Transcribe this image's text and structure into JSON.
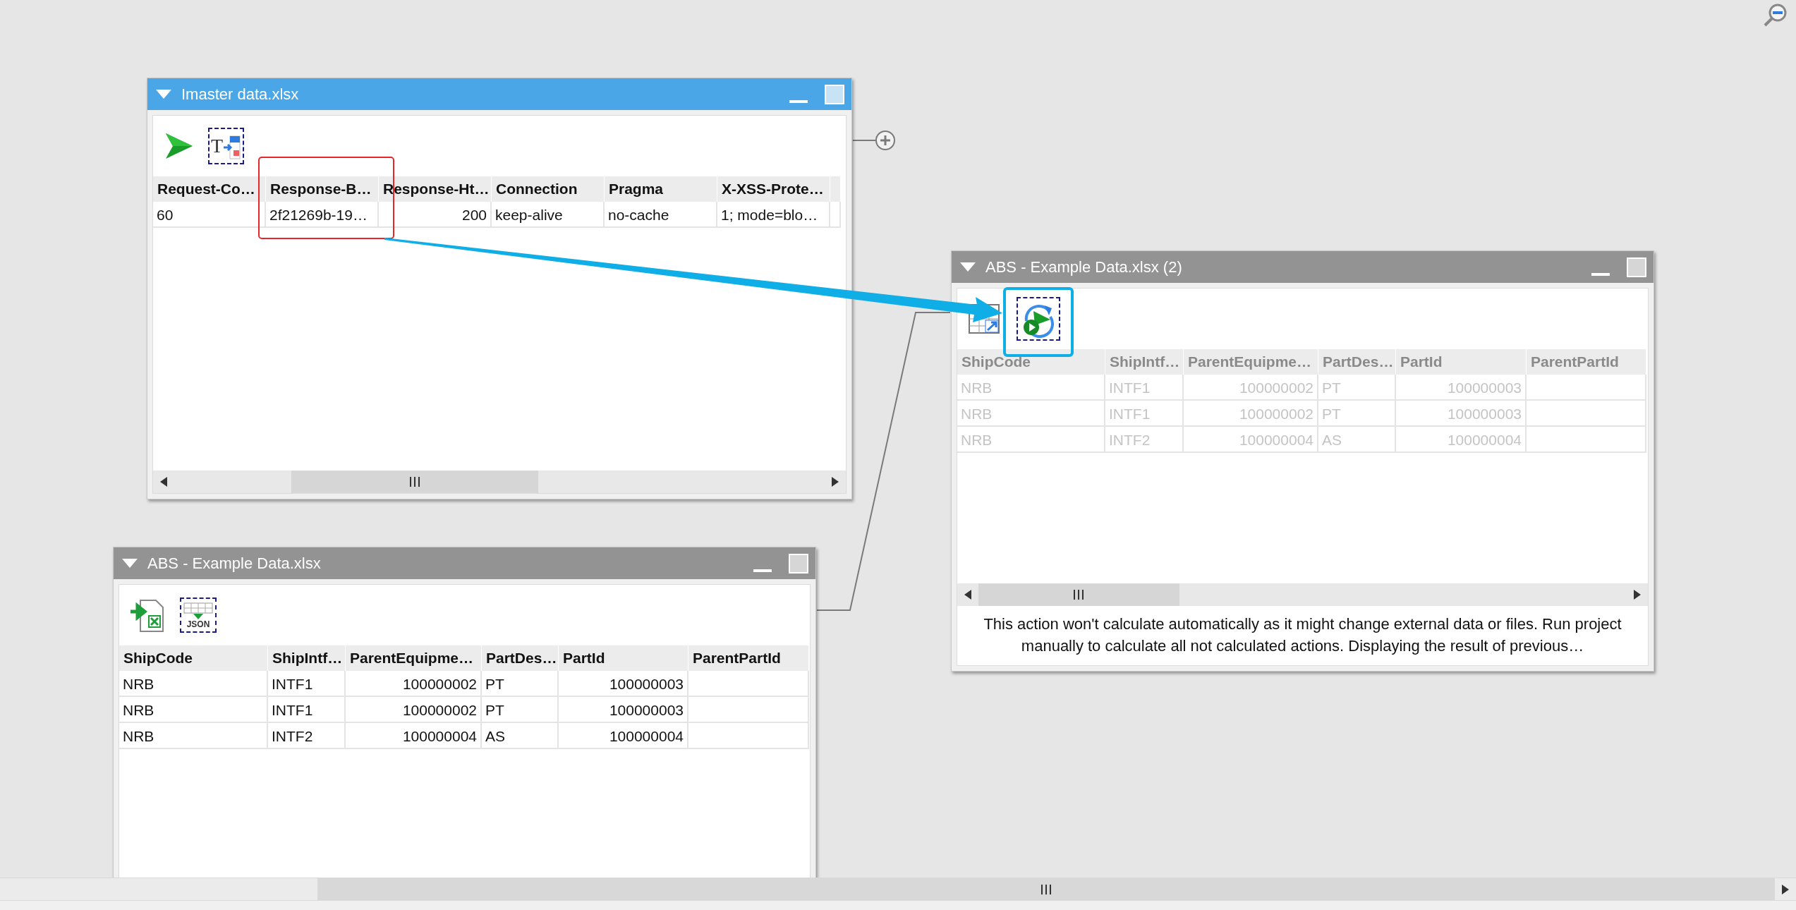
{
  "windows": [
    {
      "title": "Imaster data.xlsx",
      "active": true,
      "toolbar": [
        {
          "kind": "run",
          "selected": false
        },
        {
          "kind": "text-transform",
          "label": "T",
          "selected": true
        }
      ],
      "table": {
        "greyed": false,
        "columns": [
          "Request-Co…",
          "Response-B…",
          "Response-Ht…",
          "Connection",
          "Pragma",
          "X-XSS-Prote…"
        ],
        "rows": [
          [
            "60",
            "2f21269b-19…",
            "200",
            "keep-alive",
            "no-cache",
            "1; mode=blo…"
          ]
        ]
      }
    },
    {
      "title": "ABS - Example Data.xlsx (2)",
      "active": false,
      "toolbar": [
        {
          "kind": "table-export",
          "selected": false
        },
        {
          "kind": "run-refresh",
          "selected": true
        }
      ],
      "table": {
        "greyed": true,
        "columns": [
          "ShipCode",
          "ShipIntf…",
          "ParentEquipme…",
          "PartDes…",
          "PartId",
          "ParentPartId"
        ],
        "rows": [
          [
            "NRB",
            "INTF1",
            "100000002",
            "PT",
            "100000003",
            ""
          ],
          [
            "NRB",
            "INTF1",
            "100000002",
            "PT",
            "100000003",
            ""
          ],
          [
            "NRB",
            "INTF2",
            "100000004",
            "AS",
            "100000004",
            ""
          ]
        ]
      },
      "message": "This action won't calculate automatically as it might change external data or files. Run project manually to calculate all not calculated actions. Displaying the result of previous…"
    },
    {
      "title": "ABS - Example Data.xlsx",
      "active": false,
      "toolbar": [
        {
          "kind": "excel-import",
          "selected": false
        },
        {
          "kind": "json-table",
          "label": "JSON",
          "selected": true
        }
      ],
      "table": {
        "greyed": false,
        "columns": [
          "ShipCode",
          "ShipIntf…",
          "ParentEquipme…",
          "PartDes…",
          "PartId",
          "ParentPartId"
        ],
        "rows": [
          [
            "NRB",
            "INTF1",
            "100000002",
            "PT",
            "100000003",
            ""
          ],
          [
            "NRB",
            "INTF1",
            "100000002",
            "PT",
            "100000003",
            ""
          ],
          [
            "NRB",
            "INTF2",
            "100000004",
            "AS",
            "100000004",
            ""
          ]
        ]
      }
    }
  ]
}
